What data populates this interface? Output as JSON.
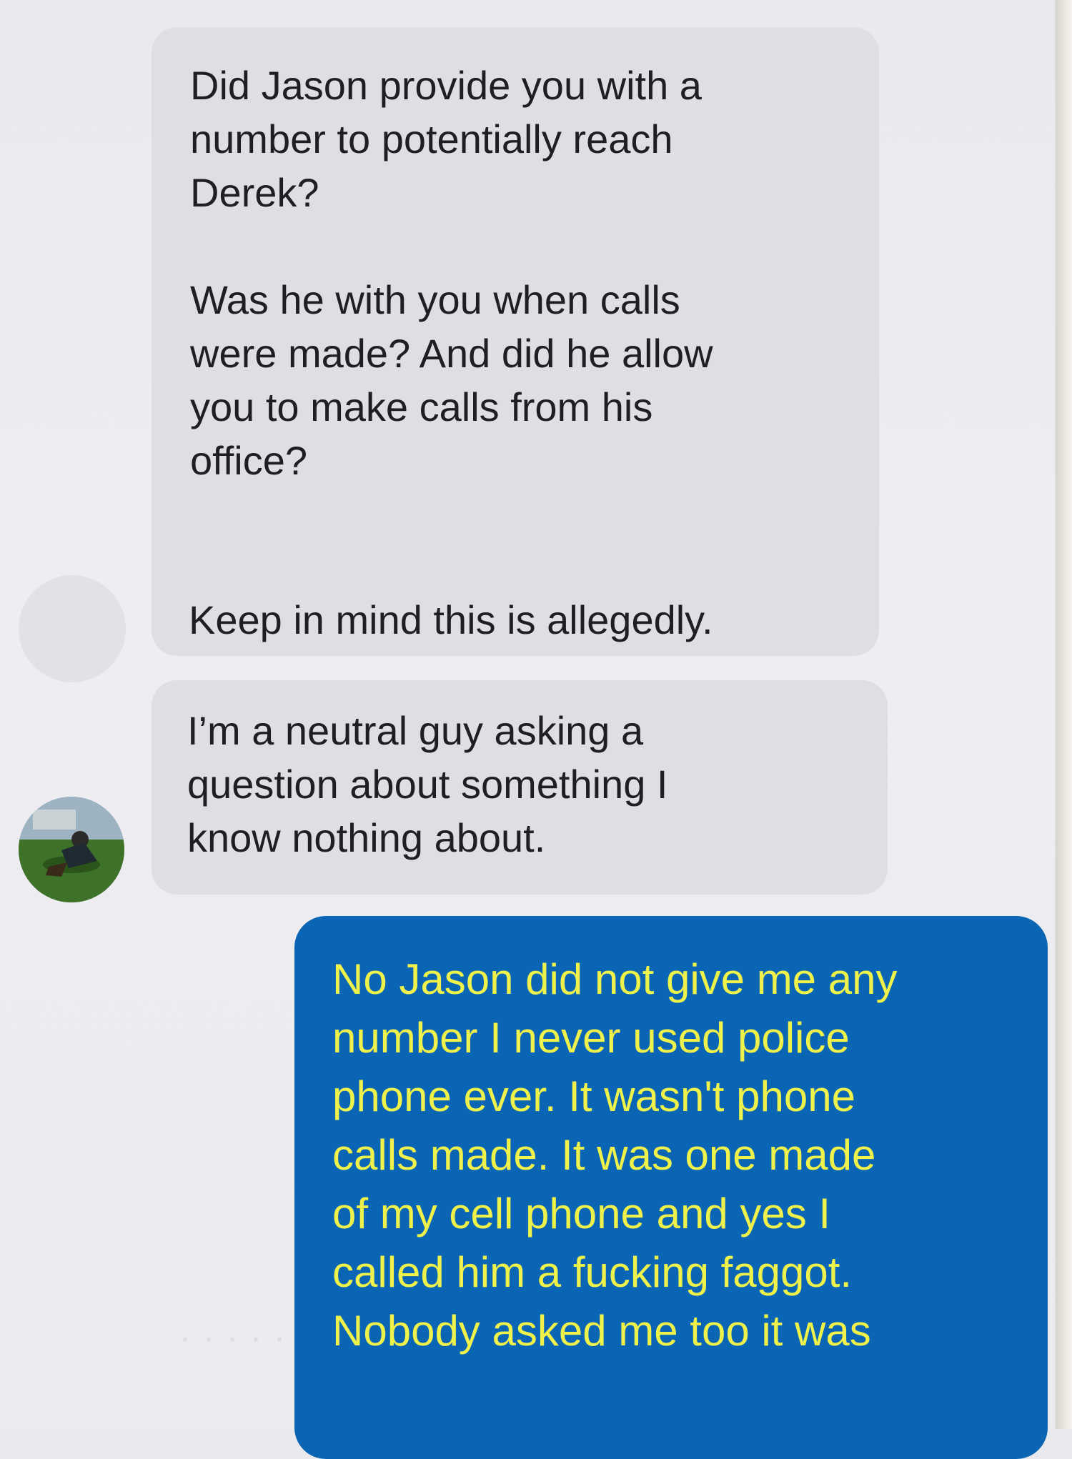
{
  "conversation": {
    "incoming": [
      {
        "text": "Did Jason provide you with a\nnumber to potentially reach\nDerek?\n\nWas he with you when calls\nwere made? And did he allow\nyou to make calls from his\noffice?"
      },
      {
        "text": "Keep in mind this is allegedly."
      },
      {
        "text": "I’m a neutral guy asking a\nquestion about something I\nknow nothing about."
      }
    ],
    "outgoing": [
      {
        "text": "No Jason did not give me any\nnumber  I never used police\nphone ever.  It wasn't phone\ncalls made.    It was one made\nof my cell phone and yes I\ncalled him a fucking faggot.\nNobody asked me too     it was"
      }
    ]
  },
  "colors": {
    "incoming_bubble": "#dedee4",
    "outgoing_bubble": "#0a66b5",
    "outgoing_text_highlight": "#eef24a"
  },
  "icons": {
    "sender_avatar": "avatar-photo"
  }
}
